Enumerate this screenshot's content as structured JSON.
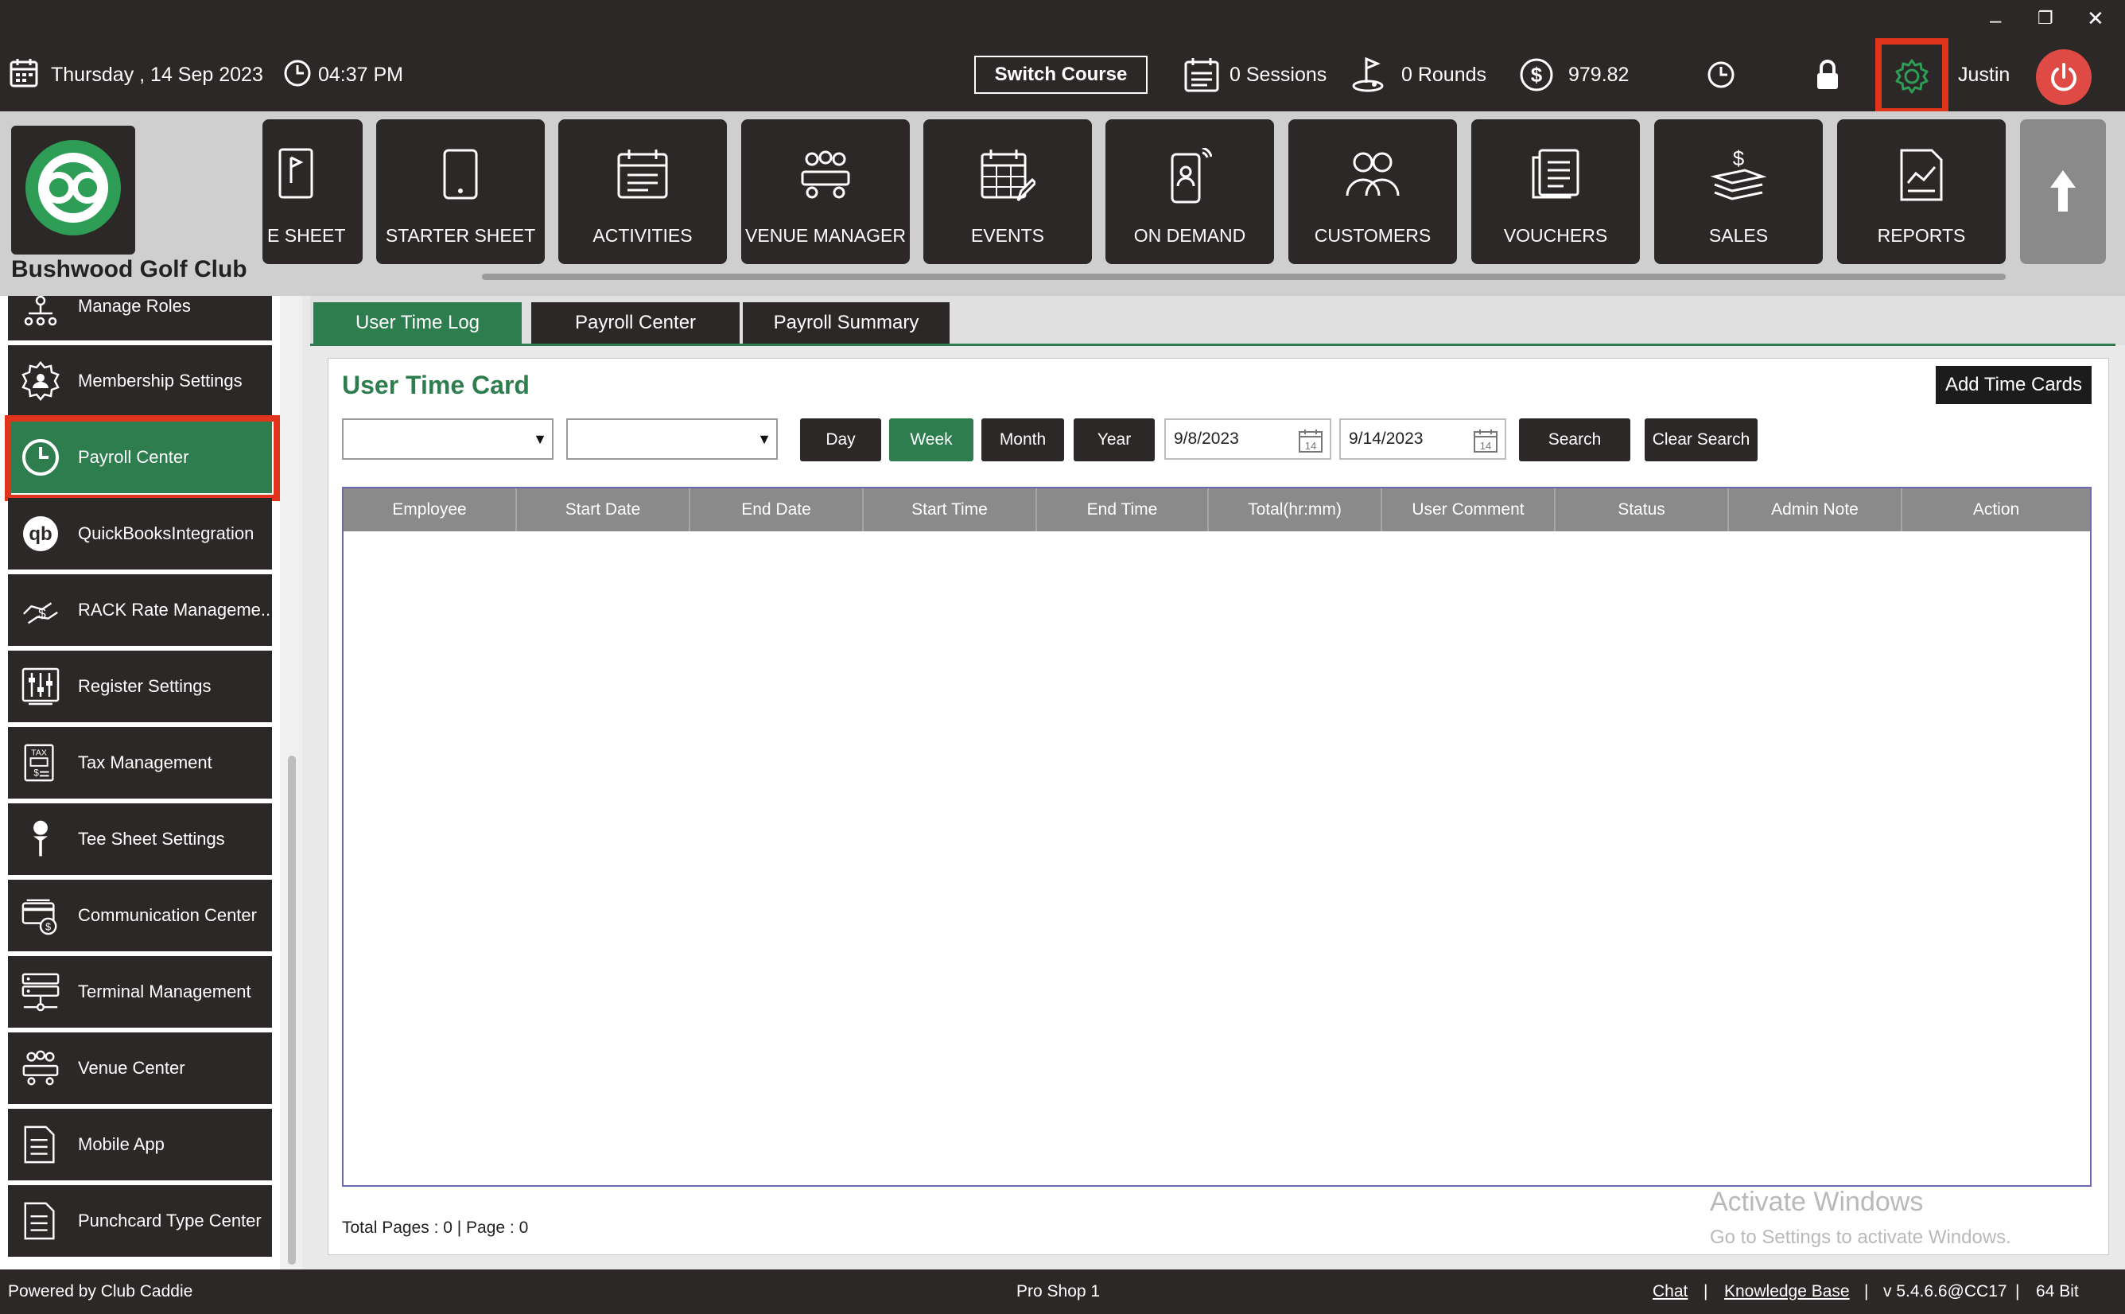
{
  "window": {
    "minimize_glyph": "–",
    "restore_glyph": "❐",
    "close_glyph": "✕"
  },
  "topbar": {
    "date": "Thursday ,  14 Sep 2023",
    "time": "04:37 PM",
    "switch_course": "Switch Course",
    "sessions": "0 Sessions",
    "rounds": "0 Rounds",
    "balance": "979.82",
    "user": "Justin"
  },
  "brand": {
    "club_name": "Bushwood Golf Club"
  },
  "nav": {
    "tiles": [
      {
        "label": "E SHEET",
        "icon": "tee-sheet-icon"
      },
      {
        "label": "STARTER SHEET",
        "icon": "tablet-icon"
      },
      {
        "label": "ACTIVITIES",
        "icon": "calendar-list-icon"
      },
      {
        "label": "VENUE MANAGER",
        "icon": "meeting-icon"
      },
      {
        "label": "EVENTS",
        "icon": "calendar-edit-icon"
      },
      {
        "label": "ON DEMAND",
        "icon": "phone-user-icon"
      },
      {
        "label": "CUSTOMERS",
        "icon": "users-icon"
      },
      {
        "label": "VOUCHERS",
        "icon": "voucher-icon"
      },
      {
        "label": "SALES",
        "icon": "money-stack-icon"
      },
      {
        "label": "REPORTS",
        "icon": "report-icon"
      }
    ]
  },
  "sidebar": {
    "items": [
      {
        "label": "Manage Roles"
      },
      {
        "label": "Membership Settings"
      },
      {
        "label": "Payroll Center"
      },
      {
        "label": "QuickBooksIntegration"
      },
      {
        "label": "RACK Rate Manageme..."
      },
      {
        "label": "Register Settings"
      },
      {
        "label": "Tax Management"
      },
      {
        "label": "Tee Sheet Settings"
      },
      {
        "label": "Communication Center"
      },
      {
        "label": "Terminal Management"
      },
      {
        "label": "Venue Center"
      },
      {
        "label": "Mobile App"
      },
      {
        "label": "Punchcard Type Center"
      }
    ]
  },
  "tabs": [
    {
      "label": "User Time Log"
    },
    {
      "label": "Payroll Center"
    },
    {
      "label": "Payroll Summary"
    }
  ],
  "panel": {
    "title": "User Time Card",
    "add_button": "Add Time Cards",
    "period_buttons": [
      "Day",
      "Week",
      "Month",
      "Year"
    ],
    "start_date": "9/8/2023",
    "end_date": "9/14/2023",
    "calendar_day": "14",
    "search": "Search",
    "clear_search": "Clear Search",
    "columns": [
      "Employee",
      "Start Date",
      "End Date",
      "Start Time",
      "End Time",
      "Total(hr:mm)",
      "User Comment",
      "Status",
      "Admin Note",
      "Action"
    ],
    "pager": "Total Pages : 0 | Page : 0"
  },
  "watermark": {
    "line1": "Activate Windows",
    "line2": "Go to Settings to activate Windows."
  },
  "footer": {
    "powered": "Powered by Club Caddie",
    "station": "Pro Shop 1",
    "chat": "Chat",
    "sep1": "|",
    "kb": "Knowledge Base",
    "sep2": "|",
    "version": "v 5.4.6.6@CC17",
    "sep3": "|",
    "bits": "64 Bit"
  },
  "colors": {
    "accent_green": "#2e7d4f",
    "dark": "#2c2827",
    "highlight_red": "#e0341d",
    "power_red": "#e04a45"
  }
}
